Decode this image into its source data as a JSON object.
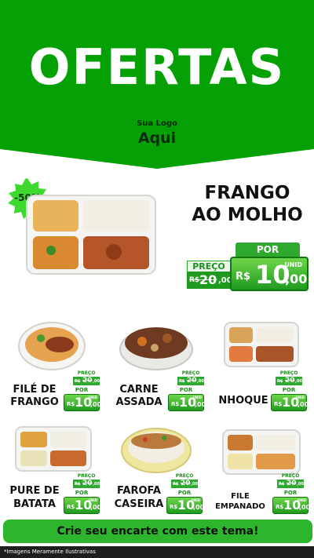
{
  "colors": {
    "brand_green": "#05a005",
    "price_green": "#2fa82f",
    "dark_text": "#0c2b0c",
    "footer_bg": "#1e1e1e"
  },
  "header": {
    "title": "OFERTAS",
    "logo_line1": "Sua Logo",
    "logo_line2": "Aqui"
  },
  "badge": {
    "label": "-50%"
  },
  "featured": {
    "name_line1": "FRANGO",
    "name_line2": "AO MOLHO",
    "old_label": "PREÇO",
    "old_currency": "R$",
    "old_int": "20",
    "old_dec": ",00",
    "new_label": "POR",
    "new_currency": "R$",
    "new_int": "10",
    "new_dec": ",00",
    "unit": "UNID"
  },
  "products": [
    {
      "name_line1": "FILÉ DE",
      "name_line2": "FRANGO",
      "old_label": "PREÇO",
      "old_currency": "R$",
      "old_int": "20",
      "old_dec": ",00",
      "new_label": "POR",
      "new_currency": "R$",
      "new_int": "10",
      "new_dec": ",00",
      "unit": "UNID"
    },
    {
      "name_line1": "CARNE",
      "name_line2": "ASSADA",
      "old_label": "PREÇO",
      "old_currency": "R$",
      "old_int": "20",
      "old_dec": ",00",
      "new_label": "POR",
      "new_currency": "R$",
      "new_int": "10",
      "new_dec": ",00",
      "unit": "UNID"
    },
    {
      "name_line1": "NHOQUE",
      "name_line2": "",
      "old_label": "PREÇO",
      "old_currency": "R$",
      "old_int": "20",
      "old_dec": ",00",
      "new_label": "POR",
      "new_currency": "R$",
      "new_int": "10",
      "new_dec": ",00",
      "unit": "UNID"
    },
    {
      "name_line1": "PURE DE",
      "name_line2": "BATATA",
      "old_label": "PREÇO",
      "old_currency": "R$",
      "old_int": "20",
      "old_dec": ",00",
      "new_label": "POR",
      "new_currency": "R$",
      "new_int": "10",
      "new_dec": ",00",
      "unit": "UNID"
    },
    {
      "name_line1": "FAROFA",
      "name_line2": "CASEIRA",
      "old_label": "PREÇO",
      "old_currency": "R$",
      "old_int": "20",
      "old_dec": ",00",
      "new_label": "POR",
      "new_currency": "R$",
      "new_int": "10",
      "new_dec": ",00",
      "unit": "UNID"
    },
    {
      "name_line1": "FILE",
      "name_line2": "EMPANADO",
      "old_label": "PREÇO",
      "old_currency": "R$",
      "old_int": "20",
      "old_dec": ",00",
      "new_label": "POR",
      "new_currency": "R$",
      "new_int": "10",
      "new_dec": ",00",
      "unit": "UNID"
    }
  ],
  "cta": {
    "label": "Crie seu encarte com este tema!"
  },
  "footer": {
    "disclaimer": "*Imagens Meramente Ilustrativas"
  }
}
